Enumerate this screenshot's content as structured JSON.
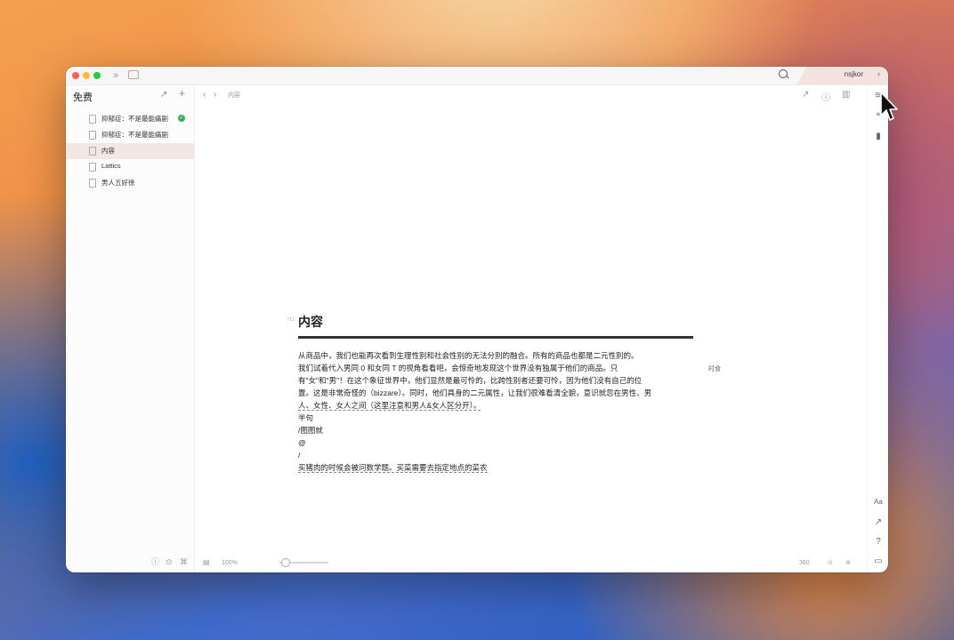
{
  "window": {
    "account_label": "nsjkor",
    "account_chevron": "›",
    "sidebar_toggle_icon": "»",
    "search_icon": "search-icon"
  },
  "sidebar": {
    "title": "免费",
    "new_window_icon": "↗",
    "add_icon": "+",
    "documents": [
      {
        "label": "抑郁症：不是最能痛剧",
        "active": false,
        "synced": true
      },
      {
        "label": "抑郁症：不是最能痛剧",
        "active": false,
        "synced": false
      },
      {
        "label": "内容",
        "active": true,
        "synced": false
      },
      {
        "label": "Lattics",
        "active": false,
        "synced": false
      },
      {
        "label": "男人五好徐",
        "active": false,
        "synced": false
      }
    ],
    "footer_icons": [
      "ⓘ",
      "⊙",
      "⌘"
    ]
  },
  "editor": {
    "nav_back": "‹",
    "nav_forward": "›",
    "breadcrumb": "内容",
    "header_icons": [
      "↗",
      "ⓘ",
      "▥"
    ],
    "title": "内容",
    "paragraphs": [
      "从商品中，我们也能再次看到生理性别和社会性别的无法分别的融合。所有的商品也都是二元性别的。",
      "我们试着代入男同 0 和女同 T 的视角看看吧，会惊奇地发现这个世界没有独属于他们的商品。只",
      "有\"女\"和\"男\"！在这个象征世界中，他们显然是最可怜的，比跨性别者还要可怜，因为他们没有自己的位",
      "置。这是非常奇怪的（bizzare）。同时，他们具身的二元属性，让我们很难看清全貌，意识就忽在男性、男",
      "人、女性、女人之间（这里注意和男人&女人区分开）。",
      "半句",
      "/图图就",
      "@",
      "/",
      "买猪肉的时候会被问数学题。买菜需要去指定地点的菜农"
    ],
    "side_note": "时食"
  },
  "footer": {
    "zoom": "100%",
    "word_count": "360",
    "status_icons": [
      "⊙",
      "⊚"
    ]
  },
  "rail": {
    "icons": [
      "≋",
      "⚬",
      "▮",
      "Aa",
      "↗",
      "?",
      "▭"
    ]
  }
}
